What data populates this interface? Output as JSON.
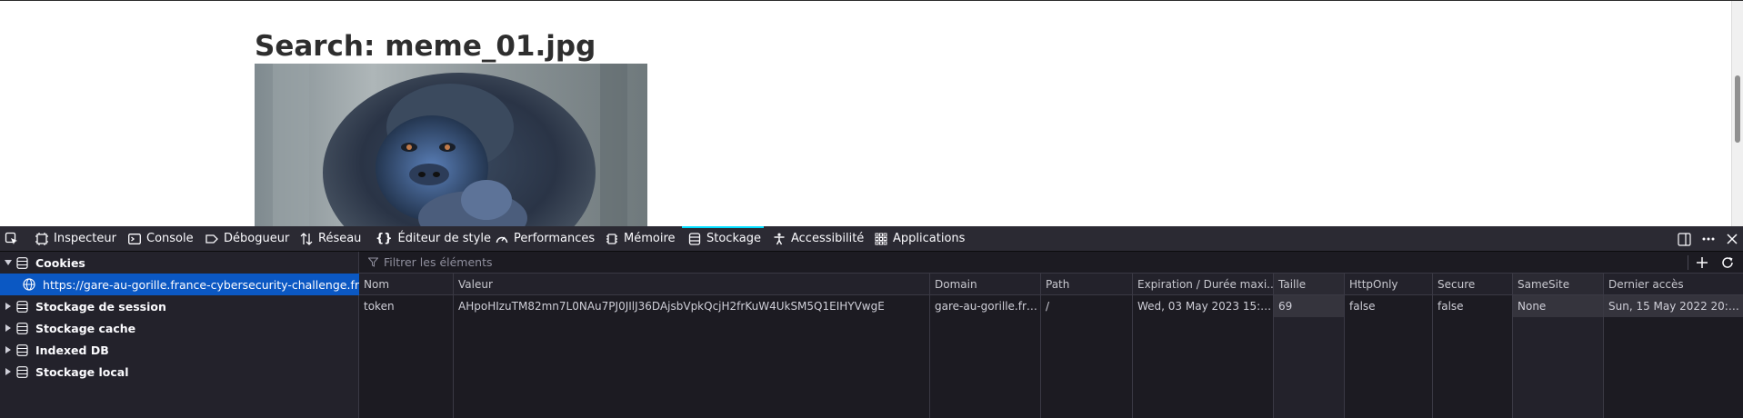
{
  "page": {
    "heading": "Search: meme_01.jpg",
    "image_alt": "gorilla-photo"
  },
  "devtools": {
    "tabs": [
      {
        "label": "Inspecteur",
        "icon": "inspector-icon"
      },
      {
        "label": "Console",
        "icon": "console-icon"
      },
      {
        "label": "Débogueur",
        "icon": "debugger-icon"
      },
      {
        "label": "Réseau",
        "icon": "network-icon"
      },
      {
        "label": "Éditeur de style",
        "icon": "style-editor-icon"
      },
      {
        "label": "Performances",
        "icon": "performance-icon"
      },
      {
        "label": "Mémoire",
        "icon": "memory-icon"
      },
      {
        "label": "Stockage",
        "icon": "storage-icon",
        "active": true
      },
      {
        "label": "Accessibilité",
        "icon": "accessibility-icon"
      },
      {
        "label": "Applications",
        "icon": "applications-icon"
      }
    ],
    "sidebar": {
      "cookies": "Cookies",
      "selected_origin": "https://gare-au-gorille.france-cybersecurity-challenge.fr",
      "session": "Stockage de session",
      "cache": "Stockage cache",
      "indexeddb": "Indexed DB",
      "local": "Stockage local"
    },
    "filter_placeholder": "Filtrer les éléments",
    "columns": {
      "name": "Nom",
      "value": "Valeur",
      "domain": "Domain",
      "path": "Path",
      "expires": "Expiration / Durée maxi...",
      "size": "Taille",
      "httponly": "HttpOnly",
      "secure": "Secure",
      "samesite": "SameSite",
      "lastaccess": "Dernier accès"
    },
    "cookie": {
      "name": "token",
      "value": "AHpoHIzuTM82mn7L0NAu7PJ0JIlJ36DAjsbVpkQcjH2frKuW4UkSM5Q1EIHYVwgE",
      "domain": "gare-au-gorille.fra...",
      "path": "/",
      "expires": "Wed, 03 May 2023 15:1...",
      "size": "69",
      "httponly": "false",
      "secure": "false",
      "samesite": "None",
      "lastaccess": "Sun, 15 May 2022 20:19..."
    },
    "colors": {
      "accent": "#00ddff",
      "selected": "#0b58c3",
      "toolbar": "#2b2a33",
      "panel": "#1c1b22"
    }
  }
}
